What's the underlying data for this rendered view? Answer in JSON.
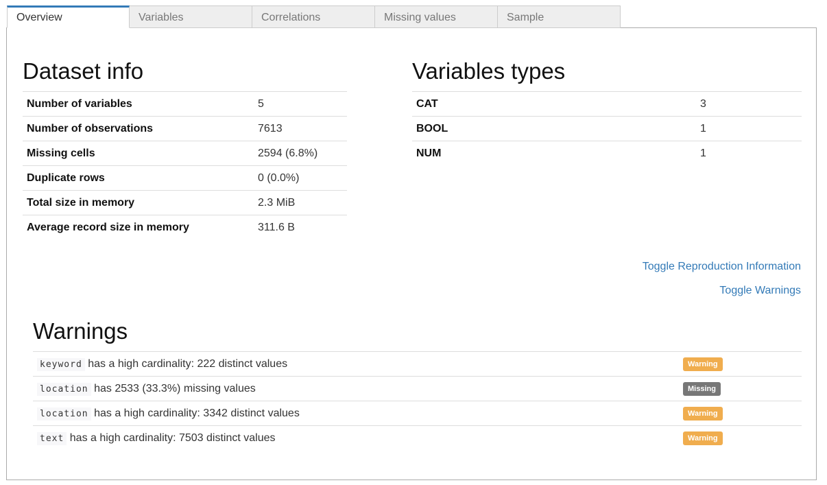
{
  "tabs": [
    {
      "label": "Overview"
    },
    {
      "label": "Variables"
    },
    {
      "label": "Correlations"
    },
    {
      "label": "Missing values"
    },
    {
      "label": "Sample"
    }
  ],
  "dataset_info": {
    "title": "Dataset info",
    "rows": [
      {
        "key": "Number of variables",
        "value": "5"
      },
      {
        "key": "Number of observations",
        "value": "7613"
      },
      {
        "key": "Missing cells",
        "value": "2594 (6.8%)"
      },
      {
        "key": "Duplicate rows",
        "value": "0 (0.0%)"
      },
      {
        "key": "Total size in memory",
        "value": "2.3 MiB"
      },
      {
        "key": "Average record size in memory",
        "value": "311.6 B"
      }
    ]
  },
  "variable_types": {
    "title": "Variables types",
    "rows": [
      {
        "key": "CAT",
        "value": "3"
      },
      {
        "key": "BOOL",
        "value": "1"
      },
      {
        "key": "NUM",
        "value": "1"
      }
    ]
  },
  "links": {
    "reproduction": "Toggle Reproduction Information",
    "warnings": "Toggle Warnings"
  },
  "warnings": {
    "title": "Warnings",
    "items": [
      {
        "variable": "keyword",
        "message": "has a high cardinality: 222 distinct values",
        "badge": "Warning"
      },
      {
        "variable": "location",
        "message": "has 2533 (33.3%) missing values",
        "badge": "Missing"
      },
      {
        "variable": "location",
        "message": "has a high cardinality: 3342 distinct values",
        "badge": "Warning"
      },
      {
        "variable": "text",
        "message": "has a high cardinality: 7503 distinct values",
        "badge": "Warning"
      }
    ]
  },
  "colors": {
    "accent": "#337ab7",
    "warning_badge": "#f0ad4e",
    "missing_badge": "#777777"
  }
}
